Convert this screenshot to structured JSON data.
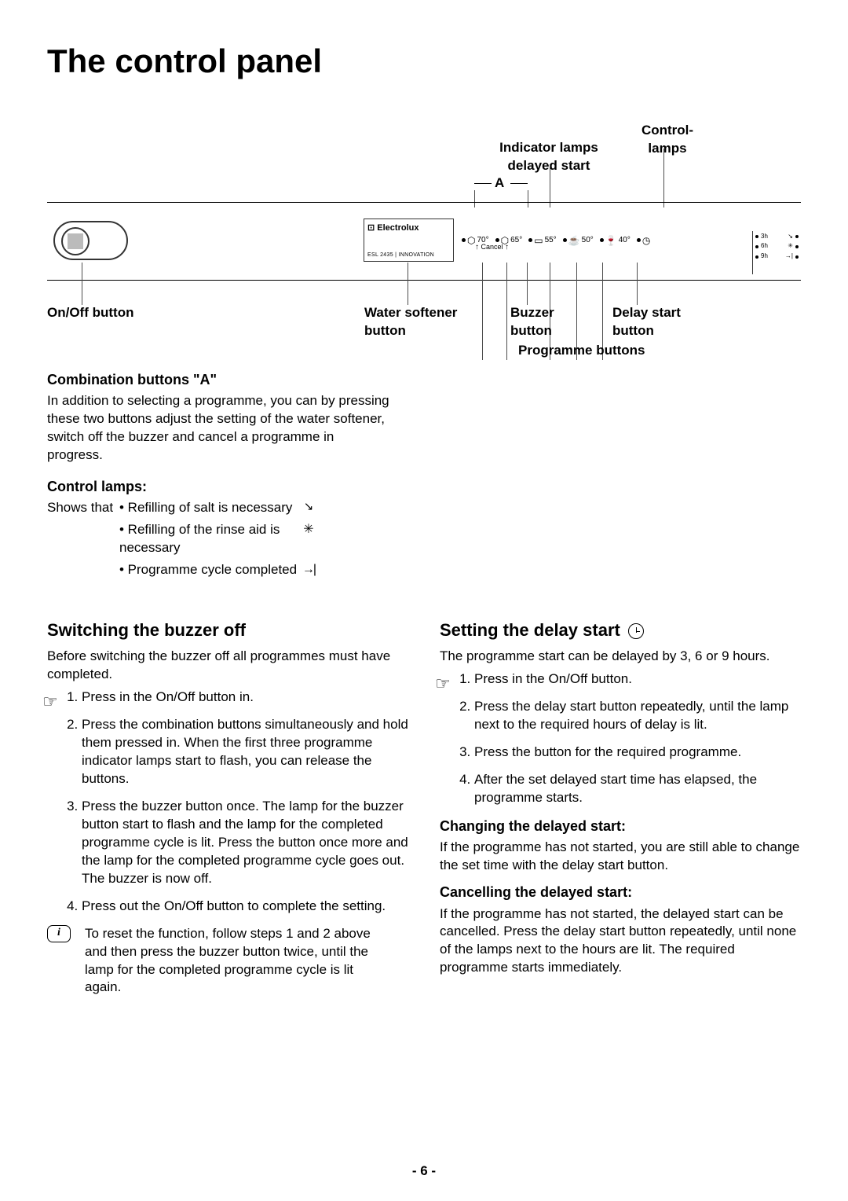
{
  "title": "The control panel",
  "diagram": {
    "indicator_label": "Indicator lamps delayed start",
    "control_lamps_label": "Control-lamps",
    "a_letter": "A",
    "brand_top": "⊡ Electrolux",
    "brand_bottom": "ESL 2435 | INNOVATION",
    "cancel_text": "Cancel",
    "progs": [
      "70°",
      "65°",
      "55°",
      "50°",
      "40°"
    ],
    "side_rows": [
      "3h",
      "6h",
      "9h"
    ]
  },
  "bottom_labels": {
    "onoff": "On/Off button",
    "water": "Water softener button",
    "buzzer": "Buzzer button",
    "delay": "Delay start button",
    "programme": "Programme buttons"
  },
  "combo": {
    "heading": "Combination buttons \"A\"",
    "text": "In addition to selecting a programme, you can by pressing these two buttons adjust the setting of the water softener, switch off the buzzer and cancel a programme in progress."
  },
  "control_lamps": {
    "heading": "Control lamps:",
    "shows": "Shows that",
    "items": [
      "• Refilling of salt is necessary",
      "• Refilling of the rinse aid is necessary",
      "• Programme cycle completed"
    ]
  },
  "buzzer_off": {
    "heading": "Switching the buzzer off",
    "intro": "Before switching the buzzer off all programmes must have completed.",
    "steps": [
      "Press in the On/Off button in.",
      "Press the combination buttons simultaneously and hold them pressed in. When the first three programme indicator lamps start to flash, you can release the buttons.",
      "Press the buzzer button once. The lamp for the buzzer button start to flash and the lamp for the completed programme cycle is lit. Press the button once more and the lamp for the completed programme cycle goes out. The buzzer is now off.",
      "Press out the On/Off button to complete the setting."
    ],
    "reset": "To reset the function, follow steps 1 and 2 above and then press the buzzer button twice, until the lamp for the completed programme cycle is lit again."
  },
  "delay_start": {
    "heading": "Setting the delay start",
    "intro": "The programme start can be delayed by 3, 6 or 9 hours.",
    "steps": [
      "Press in the On/Off button.",
      "Press the delay start button repeatedly, until the lamp next to the required hours of delay is lit.",
      "Press the button for the required programme.",
      "After the set delayed start time has elapsed, the programme starts."
    ],
    "changing_h": "Changing the delayed start:",
    "changing_t": "If the programme has not started, you are still able to change the set time with the delay start button.",
    "cancel_h": "Cancelling the delayed start:",
    "cancel_t": "If the programme has not started, the delayed start can be cancelled. Press the delay start button repeatedly, until none of the lamps next to the hours are lit. The required programme starts immediately."
  },
  "page": "- 6 -"
}
